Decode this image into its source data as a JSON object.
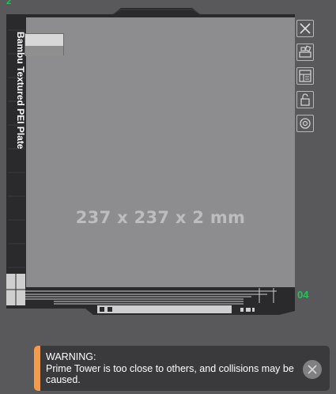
{
  "plate": {
    "name": "Bambu Textured PEI Plate",
    "dimensions": "237 x 237 x 2 mm",
    "index": "04",
    "tag": "2",
    "colors": {
      "surface": "#8d8d8f",
      "accent": "#22c35a"
    },
    "filament_swatch": {
      "top_color": "#d8d8d8",
      "bottom_color": "#8f8f90"
    }
  },
  "toolbar": {
    "buttons": [
      {
        "icon": "close-icon"
      },
      {
        "icon": "arrange-icon"
      },
      {
        "icon": "layout-icon"
      },
      {
        "icon": "lock-icon"
      },
      {
        "icon": "settings-icon"
      }
    ]
  },
  "warning": {
    "title": "WARNING:",
    "message": "Prime Tower is too close to others, and collisions may be caused.",
    "accent_color": "#f39a4d",
    "close_icon": "close-icon"
  }
}
